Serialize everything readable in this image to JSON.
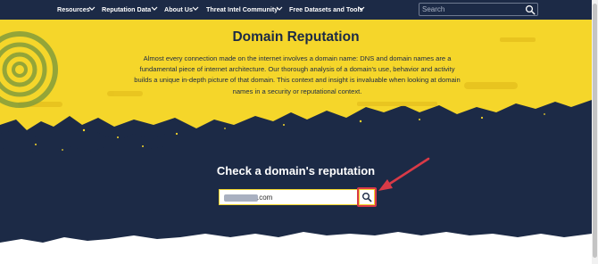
{
  "nav": {
    "items": [
      {
        "label": "Resources"
      },
      {
        "label": "Reputation Data"
      },
      {
        "label": "About Us"
      },
      {
        "label": "Threat Intel Community"
      },
      {
        "label": "Free Datasets and Tools"
      }
    ],
    "search_placeholder": "Search",
    "search_icon": "search-icon"
  },
  "hero": {
    "title": "Domain Reputation",
    "intro": "Almost every connection made on the internet involves a domain name: DNS and domain names are a fundamental piece of internet architecture. Our thorough analysis of a domain's use, behavior and activity builds a unique in-depth picture of that domain. This context and insight is invaluable when looking at domain names in a security or reputational context."
  },
  "checker": {
    "title": "Check a domain's reputation",
    "domain_value": ".com",
    "search_icon": "search-icon"
  },
  "colors": {
    "navy": "#1c2a46",
    "yellow": "#f5d62a",
    "highlight_red": "#d93a47"
  }
}
